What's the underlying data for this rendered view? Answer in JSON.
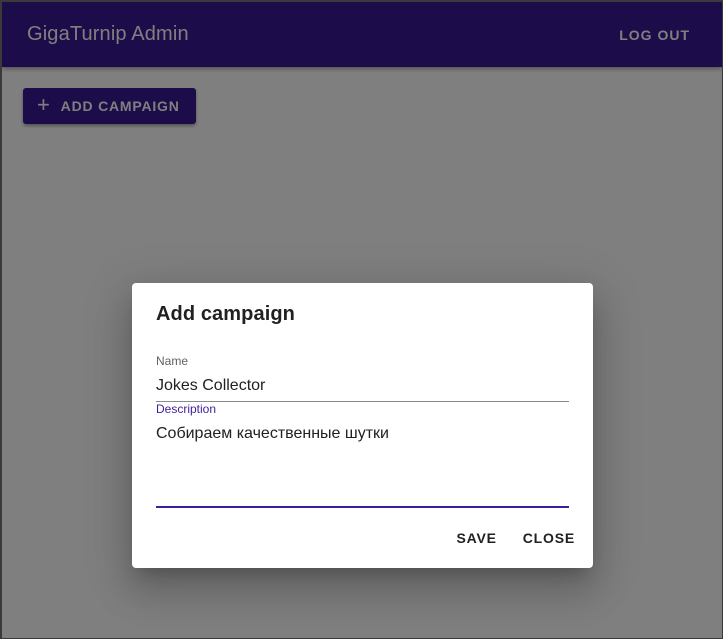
{
  "colors": {
    "brand": "#3a1895",
    "backdrop": "rgba(0,0,0,0.5)",
    "focus": "#3f1d9b"
  },
  "appbar": {
    "title": "GigaTurnip Admin",
    "logout_label": "LOG OUT"
  },
  "toolbar": {
    "add_campaign_label": "ADD CAMPAIGN",
    "add_icon": "plus-icon"
  },
  "dialog": {
    "title": "Add campaign",
    "name_field": {
      "label": "Name",
      "value": "Jokes Collector"
    },
    "description_field": {
      "label": "Description",
      "value": "Собираем качественные шутки"
    },
    "save_label": "SAVE",
    "close_label": "CLOSE"
  }
}
